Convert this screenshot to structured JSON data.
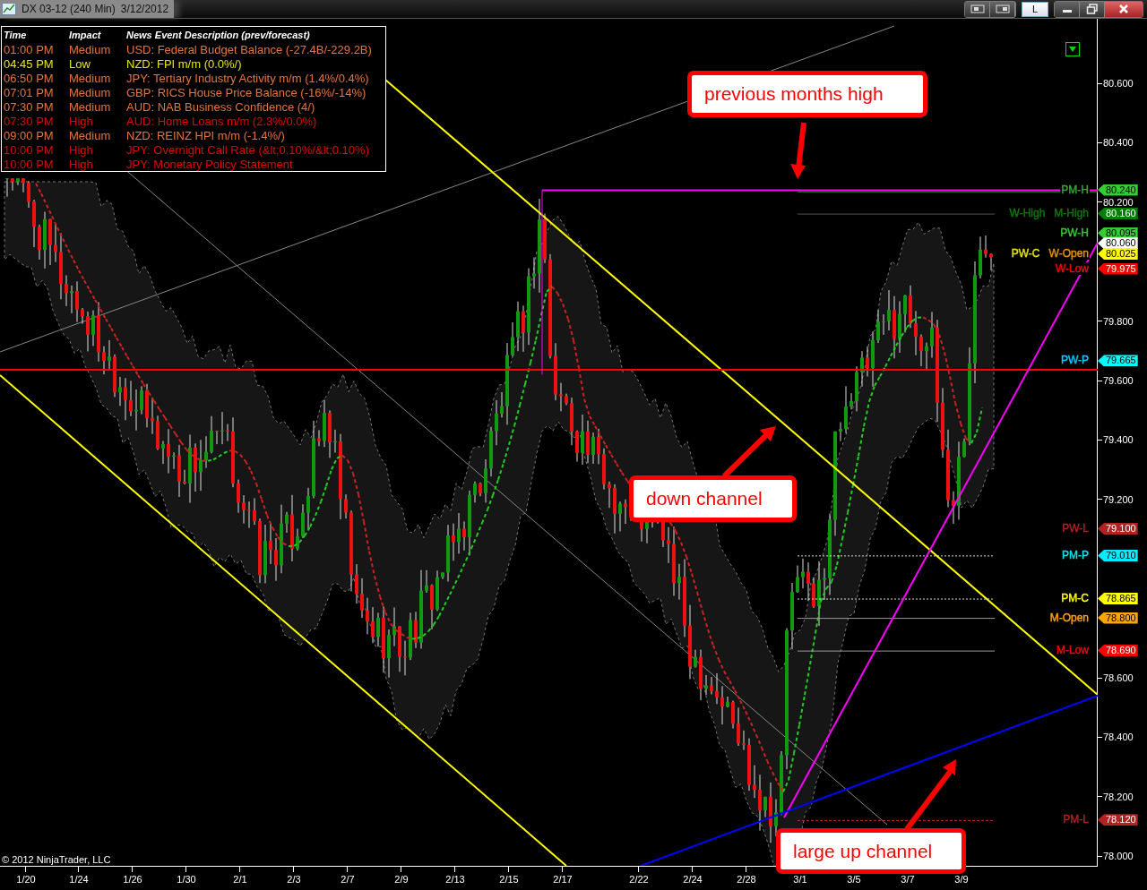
{
  "window": {
    "title": "DX 03-12 (240 Min)",
    "date": "3/12/2012",
    "mode_button": "L"
  },
  "news_panel": {
    "columns": [
      "Time",
      "Impact",
      "News Event Description (prev/forecast)"
    ],
    "rows": [
      {
        "time": "01:00 PM",
        "impact": "Medium",
        "description": "USD: Federal Budget Balance (-27.4B/-229.2B)",
        "color": "#e8743b"
      },
      {
        "time": "04:45 PM",
        "impact": "Low",
        "description": "NZD: FPI m/m (0.0%/)",
        "color": "#e6e600"
      },
      {
        "time": "06:50 PM",
        "impact": "Medium",
        "description": "JPY: Tertiary Industry Activity m/m (1.4%/0.4%)",
        "color": "#e8743b"
      },
      {
        "time": "07:01 PM",
        "impact": "Medium",
        "description": "GBP: RICS House Price Balance (-16%/-14%)",
        "color": "#e8743b"
      },
      {
        "time": "07:30 PM",
        "impact": "Medium",
        "description": "AUD: NAB Business Confidence (4/)",
        "color": "#e8743b"
      },
      {
        "time": "07:30 PM",
        "impact": "High",
        "description": "AUD: Home Loans m/m (2.3%/0.0%)",
        "color": "#e60000"
      },
      {
        "time": "09:00 PM",
        "impact": "Medium",
        "description": "NZD: REINZ HPI m/m (-1.4%/)",
        "color": "#e8743b"
      },
      {
        "time": "10:00 PM",
        "impact": "High",
        "description": "JPY: Overnight Call Rate (&lt;0.10%/&lt;0.10%)",
        "color": "#e60000"
      },
      {
        "time": "10:00 PM",
        "impact": "High",
        "description": "JPY: Monetary Policy Statement",
        "color": "#e60000"
      }
    ]
  },
  "price_axis": {
    "ticks": [
      "80.600",
      "80.400",
      "80.200",
      "79.800",
      "79.600",
      "79.400",
      "79.200",
      "78.600",
      "78.400",
      "78.200",
      "78.000"
    ]
  },
  "levels": [
    {
      "labels": [
        {
          "text": "PM-H",
          "color": "#33aa33"
        }
      ],
      "tag": {
        "value": "80.240",
        "color": "#33cc33"
      }
    },
    {
      "labels": [
        {
          "text": "W-High",
          "color": "#0b7a0b"
        },
        {
          "text": "M-High",
          "color": "#0b7a0b"
        }
      ],
      "tag": {
        "value": "80.160",
        "color": "#008000"
      }
    },
    {
      "labels": [
        {
          "text": "PW-H",
          "color": "#33cc33"
        }
      ],
      "tag": {
        "value": "80.095",
        "color": "#33cc33"
      }
    },
    {
      "tag": {
        "value": "80.060",
        "color": "#ffffff"
      }
    },
    {
      "labels": [
        {
          "text": "PW-C",
          "color": "#e6e600"
        },
        {
          "text": "W-Open",
          "color": "#e69500"
        }
      ],
      "tag": {
        "value": "80.025",
        "color": "#ffff00"
      }
    },
    {
      "labels": [
        {
          "text": "W-Low",
          "color": "#ff0000"
        }
      ],
      "tag": {
        "value": "79.975",
        "color": "#ff0000"
      }
    },
    {
      "labels": [
        {
          "text": "PW-P",
          "color": "#00ccff"
        }
      ],
      "tag": {
        "value": "79.665",
        "color": "#00ffff"
      }
    },
    {
      "labels": [
        {
          "text": "PW-L",
          "color": "#b22222"
        }
      ],
      "tag": {
        "value": "79.100",
        "color": "#b22222"
      }
    },
    {
      "labels": [
        {
          "text": "PM-P",
          "color": "#00e5ee"
        }
      ],
      "tag": {
        "value": "79.010",
        "color": "#00eeff"
      }
    },
    {
      "labels": [
        {
          "text": "PM-C",
          "color": "#ffff00"
        }
      ],
      "tag": {
        "value": "78.865",
        "color": "#ffff00"
      }
    },
    {
      "labels": [
        {
          "text": "M-Open",
          "color": "#ffa500"
        }
      ],
      "tag": {
        "value": "78.800",
        "color": "#ffa500"
      }
    },
    {
      "labels": [
        {
          "text": "M-Low",
          "color": "#ff0000"
        }
      ],
      "tag": {
        "value": "78.690",
        "color": "#ff0000"
      }
    },
    {
      "labels": [
        {
          "text": "PM-L",
          "color": "#b22222"
        }
      ],
      "tag": {
        "value": "78.120",
        "color": "#b22222"
      }
    }
  ],
  "date_axis": [
    "1/20",
    "1/24",
    "1/26",
    "1/30",
    "2/1",
    "2/3",
    "2/7",
    "2/9",
    "2/13",
    "2/15",
    "2/17",
    "2/22",
    "2/24",
    "2/28",
    "3/1",
    "3/5",
    "3/7",
    "3/9"
  ],
  "annotations": [
    "previous months high",
    "down channel",
    "large up channel"
  ],
  "copyright": "© 2012 NinjaTrader, LLC"
}
